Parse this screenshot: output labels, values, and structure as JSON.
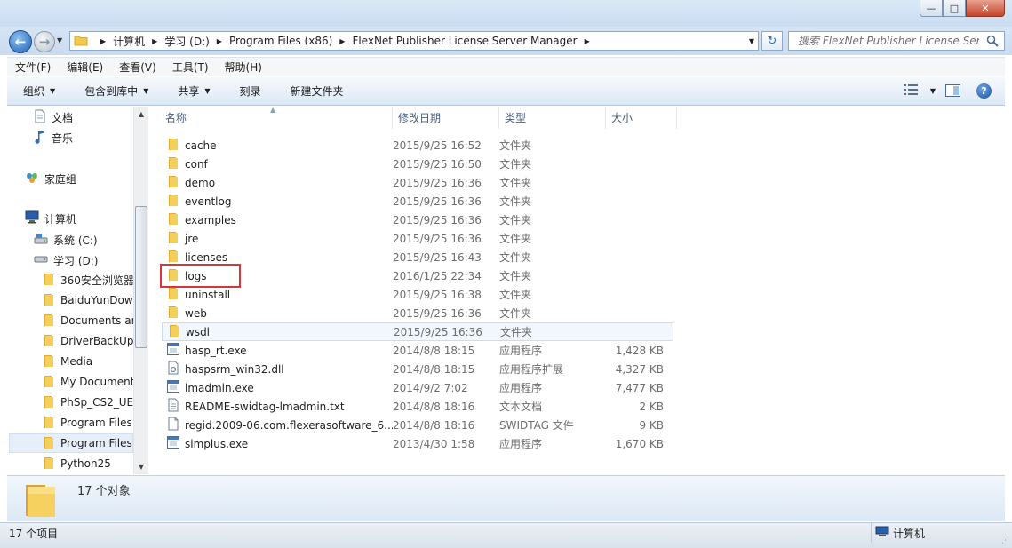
{
  "window": {
    "controls": {
      "minimize": "—",
      "maximize": "□",
      "close": "✕"
    }
  },
  "nav": {
    "back_glyph": "←",
    "forward_glyph": "→",
    "breadcrumb": [
      "计算机",
      "学习 (D:)",
      "Program Files (x86)",
      "FlexNet Publisher License Server Manager"
    ],
    "refresh_glyph": "↻"
  },
  "search": {
    "placeholder": "搜索 FlexNet Publisher License Ser..."
  },
  "menubar": {
    "items": [
      "文件(F)",
      "编辑(E)",
      "查看(V)",
      "工具(T)",
      "帮助(H)"
    ]
  },
  "toolbar": {
    "organize": "组织",
    "include_in_library": "包含到库中",
    "share": "共享",
    "burn": "刻录",
    "new_folder": "新建文件夹",
    "help_glyph": "?"
  },
  "navpane": {
    "items": [
      {
        "label": "文档",
        "icon": "document-icon"
      },
      {
        "label": "音乐",
        "icon": "music-icon"
      },
      {
        "label": "家庭组",
        "icon": "homegroup-icon"
      },
      {
        "label": "计算机",
        "icon": "computer-icon"
      },
      {
        "label": "系统 (C:)",
        "icon": "drive-icon"
      },
      {
        "label": "学习 (D:)",
        "icon": "drive-icon"
      },
      {
        "label": "360安全浏览器",
        "icon": "folder-icon"
      },
      {
        "label": "BaiduYunDow",
        "icon": "folder-icon"
      },
      {
        "label": "Documents ar",
        "icon": "folder-icon"
      },
      {
        "label": "DriverBackUp",
        "icon": "folder-icon"
      },
      {
        "label": "Media",
        "icon": "folder-icon"
      },
      {
        "label": "My Document",
        "icon": "folder-icon"
      },
      {
        "label": "PhSp_CS2_UE_",
        "icon": "folder-icon"
      },
      {
        "label": "Program Files",
        "icon": "folder-icon"
      },
      {
        "label": "Program Files",
        "icon": "folder-icon"
      },
      {
        "label": "Python25",
        "icon": "folder-icon"
      }
    ]
  },
  "columns": {
    "name": "名称",
    "modified": "修改日期",
    "type": "类型",
    "size": "大小"
  },
  "files": [
    {
      "name": "cache",
      "date": "2015/9/25 16:52",
      "type": "文件夹",
      "size": "",
      "icon": "folder-icon"
    },
    {
      "name": "conf",
      "date": "2015/9/25 16:50",
      "type": "文件夹",
      "size": "",
      "icon": "folder-icon"
    },
    {
      "name": "demo",
      "date": "2015/9/25 16:36",
      "type": "文件夹",
      "size": "",
      "icon": "folder-icon"
    },
    {
      "name": "eventlog",
      "date": "2015/9/25 16:36",
      "type": "文件夹",
      "size": "",
      "icon": "folder-icon"
    },
    {
      "name": "examples",
      "date": "2015/9/25 16:36",
      "type": "文件夹",
      "size": "",
      "icon": "folder-icon"
    },
    {
      "name": "jre",
      "date": "2015/9/25 16:36",
      "type": "文件夹",
      "size": "",
      "icon": "folder-icon"
    },
    {
      "name": "licenses",
      "date": "2015/9/25 16:43",
      "type": "文件夹",
      "size": "",
      "icon": "folder-icon"
    },
    {
      "name": "logs",
      "date": "2016/1/25 22:34",
      "type": "文件夹",
      "size": "",
      "icon": "folder-icon"
    },
    {
      "name": "uninstall",
      "date": "2015/9/25 16:38",
      "type": "文件夹",
      "size": "",
      "icon": "folder-icon"
    },
    {
      "name": "web",
      "date": "2015/9/25 16:36",
      "type": "文件夹",
      "size": "",
      "icon": "folder-icon"
    },
    {
      "name": "wsdl",
      "date": "2015/9/25 16:36",
      "type": "文件夹",
      "size": "",
      "icon": "folder-icon"
    },
    {
      "name": "hasp_rt.exe",
      "date": "2014/8/8 18:15",
      "type": "应用程序",
      "size": "1,428 KB",
      "icon": "exe-icon"
    },
    {
      "name": "haspsrm_win32.dll",
      "date": "2014/8/8 18:15",
      "type": "应用程序扩展",
      "size": "4,327 KB",
      "icon": "dll-icon"
    },
    {
      "name": "lmadmin.exe",
      "date": "2014/9/2 7:02",
      "type": "应用程序",
      "size": "7,477 KB",
      "icon": "exe-icon"
    },
    {
      "name": "README-swidtag-lmadmin.txt",
      "date": "2014/8/8 18:16",
      "type": "文本文档",
      "size": "2 KB",
      "icon": "text-file-icon"
    },
    {
      "name": "regid.2009-06.com.flexerasoftware_6...",
      "date": "2014/8/8 18:16",
      "type": "SWIDTAG 文件",
      "size": "9 KB",
      "icon": "file-icon"
    },
    {
      "name": "simplus.exe",
      "date": "2013/4/30 1:58",
      "type": "应用程序",
      "size": "1,670 KB",
      "icon": "exe-icon"
    }
  ],
  "details": {
    "count": "17 个对象"
  },
  "status": {
    "items_count": "17 个项目",
    "location": "计算机"
  },
  "colors": {
    "highlight": "#d9353a",
    "folder": "#f2c94c",
    "selection": "#cddcf0"
  }
}
